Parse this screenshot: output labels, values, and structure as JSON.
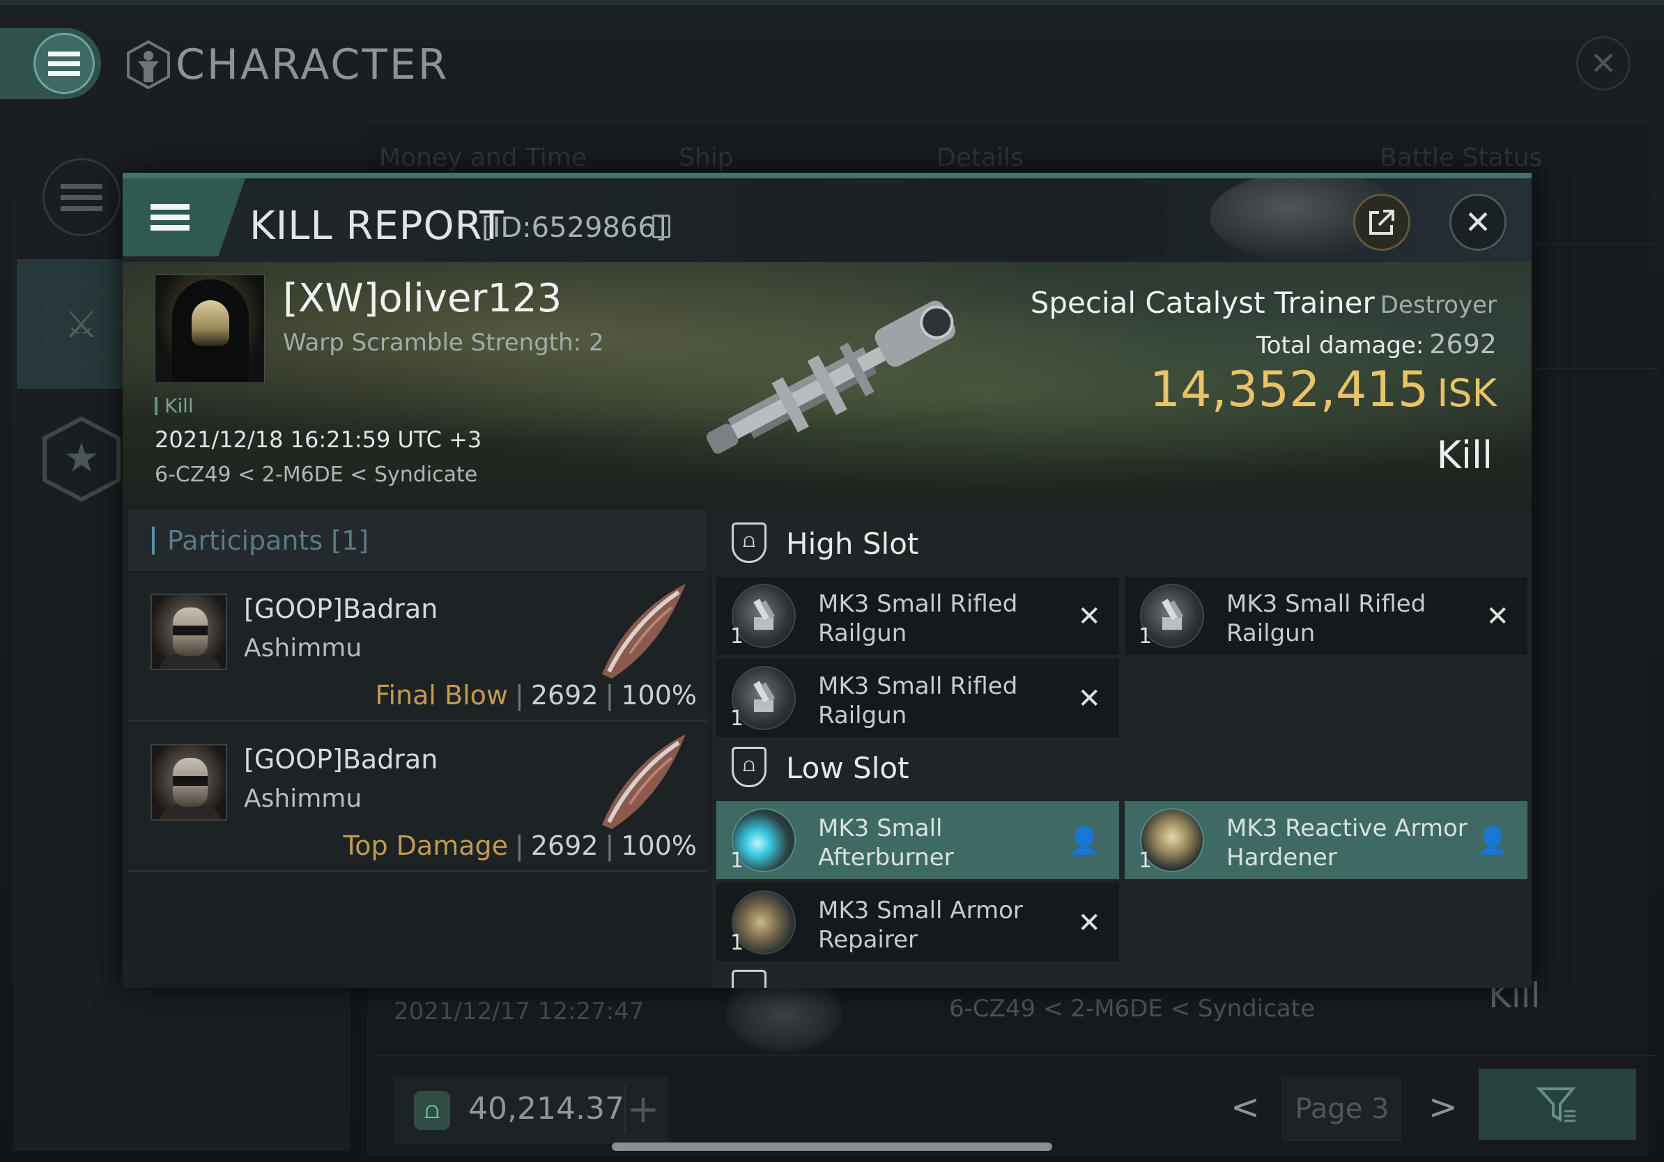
{
  "background": {
    "window_title": "CHARACTER",
    "column_headers": [
      "Money and Time",
      "Ship",
      "Details",
      "Battle Status"
    ],
    "row": {
      "date": "2021/12/17  12:27:47",
      "location": "6-CZ49 < 2-M6DE < Syndicate",
      "status": "Kill"
    },
    "wallet": {
      "amount": "40,214.37",
      "add_label": "+"
    },
    "pager": {
      "prev": "<",
      "page": "Page 3",
      "next": ">"
    }
  },
  "kill_report": {
    "title": "KILL REPORT",
    "id": "[ID:6529866]",
    "victim": {
      "name": "[XW]oliver123",
      "warp": "Warp Scramble Strength: 2",
      "tag": "Kill",
      "datetime": "2021/12/18 16:21:59 UTC +3",
      "location": "6-CZ49 < 2-M6DE < Syndicate"
    },
    "ship": {
      "name": "Special Catalyst Trainer",
      "class": "Destroyer",
      "total_damage_label": "Total damage:",
      "total_damage": "2692",
      "isk_value": "14,352,415",
      "isk_unit": "ISK",
      "result": "Kill"
    },
    "participants": {
      "header": "Participants [1]",
      "rows": [
        {
          "name": "[GOOP]Badran",
          "ship": "Ashimmu",
          "label": "Final Blow",
          "damage": "2692",
          "percent": "100%"
        },
        {
          "name": "[GOOP]Badran",
          "ship": "Ashimmu",
          "label": "Top Damage",
          "damage": "2692",
          "percent": "100%"
        }
      ]
    },
    "high_slot": {
      "label": "High Slot",
      "items": [
        {
          "qty": "1",
          "name": "MK3 Small Rifled Railgun",
          "state": "✕"
        },
        {
          "qty": "1",
          "name": "MK3 Small Rifled Railgun",
          "state": "✕"
        },
        {
          "qty": "1",
          "name": "MK3 Small Rifled Railgun",
          "state": "✕"
        }
      ]
    },
    "low_slot": {
      "label": "Low Slot",
      "items": [
        {
          "qty": "1",
          "name": "MK3 Small Afterburner",
          "state": "person-icon"
        },
        {
          "qty": "1",
          "name": "MK3 Reactive Armor Hardener",
          "state": "person-icon"
        },
        {
          "qty": "1",
          "name": "MK3 Small Armor Repairer",
          "state": "✕"
        }
      ]
    }
  },
  "colors": {
    "accent_teal": "#45736b",
    "isk_gold": "#e8c36a",
    "fitted_bg": "#3f6a64"
  }
}
